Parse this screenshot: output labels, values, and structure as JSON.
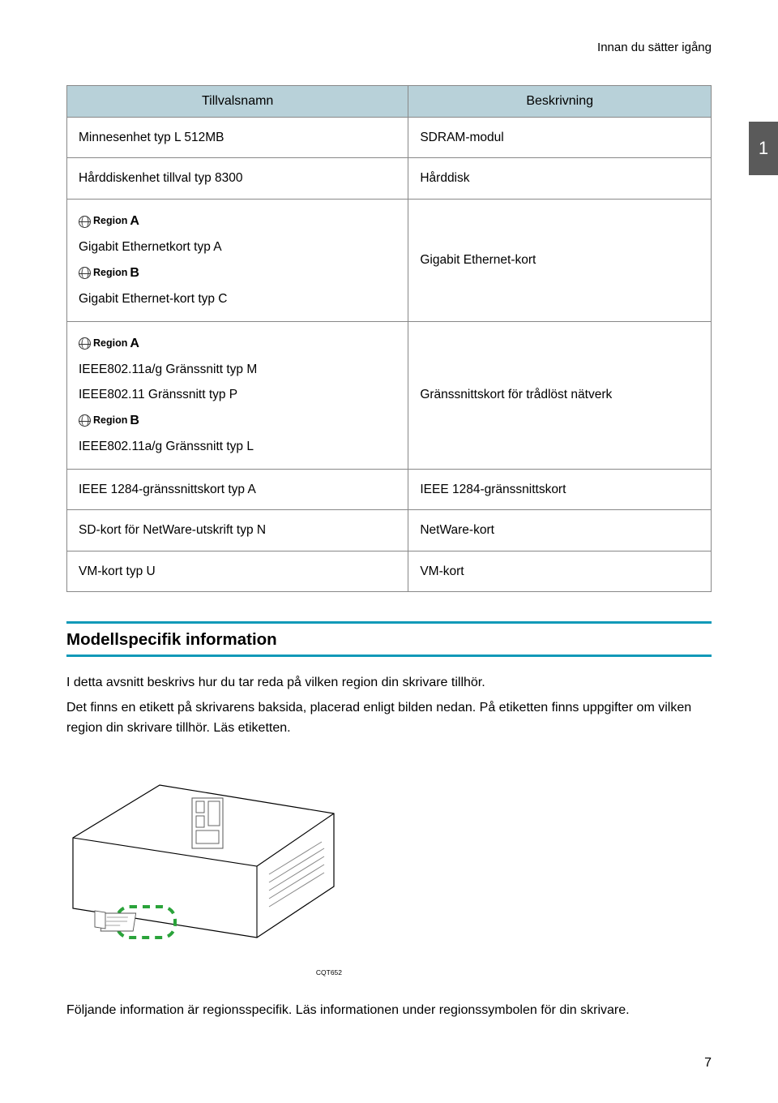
{
  "header": {
    "title": "Innan du sätter igång"
  },
  "page_tab": "1",
  "table": {
    "head": {
      "col1": "Tillvalsnamn",
      "col2": "Beskrivning"
    },
    "rows": [
      {
        "c1": "Minnesenhet typ L 512MB",
        "c2": "SDRAM-modul"
      },
      {
        "c1": "Hårddiskenhet tillval typ 8300",
        "c2": "Hårddisk"
      },
      {
        "c1_regionA": "Region",
        "c1_line1": "Gigabit Ethernetkort typ A",
        "c1_regionB": "Region",
        "c1_line2": "Gigabit Ethernet-kort typ C",
        "c2": "Gigabit Ethernet-kort"
      },
      {
        "c1_regionA": "Region",
        "c1_line1": "IEEE802.11a/g Gränssnitt typ M",
        "c1_line2": "IEEE802.11 Gränssnitt typ P",
        "c1_regionB": "Region",
        "c1_line3": "IEEE802.11a/g Gränssnitt typ L",
        "c2": "Gränssnittskort för trådlöst nätverk"
      },
      {
        "c1": "IEEE 1284-gränssnittskort typ A",
        "c2": "IEEE 1284-gränssnittskort"
      },
      {
        "c1": "SD-kort för NetWare-utskrift typ N",
        "c2": "NetWare-kort"
      },
      {
        "c1": "VM-kort typ U",
        "c2": "VM-kort"
      }
    ]
  },
  "section": {
    "heading": "Modellspecifik information",
    "para1": "I detta avsnitt beskrivs hur du tar reda på vilken region din skrivare tillhör.",
    "para2": "Det finns en etikett på skrivarens baksida, placerad enligt bilden nedan. På etiketten finns uppgifter om vilken region din skrivare tillhör. Läs etiketten.",
    "img_code": "CQT652",
    "footer_text": "Följande information är regionsspecifik. Läs informationen under regionssymbolen för din skrivare."
  },
  "page_number": "7",
  "letters": {
    "A": "A",
    "B": "B"
  }
}
